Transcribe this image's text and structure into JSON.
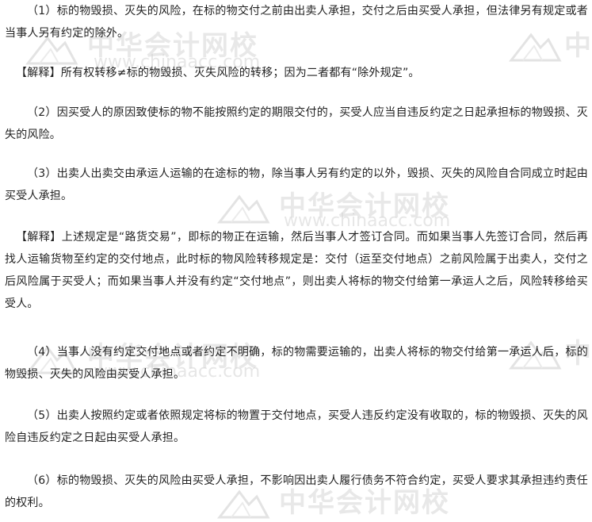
{
  "document": {
    "paragraphs": [
      "（1）标的物毁损、灭失的风险，在标的物交付之前由出卖人承担，交付之后由买受人承担，但法律另有规定或者当事人另有约定的除外。",
      "【解释】所有权转移≠标的物毁损、灭失风险的转移；因为二者都有“除外规定”。",
      "（2）因买受人的原因致使标的物不能按照约定的期限交付的，买受人应当自违反约定之日起承担标的物毁损、灭失的风险。",
      "（3）出卖人出卖交由承运人运输的在途标的物，除当事人另有约定的以外，毁损、灭失的风险自合同成立时起由买受人承担。",
      "【解释】上述规定是“路货交易”，即标的物正在运输，然后当事人才签订合同。而如果当事人先签订合同，然后再找人运输货物至约定的交付地点，此时标的物风险转移规定是：交付（运至交付地点）之前风险属于出卖人，交付之后风险属于买受人；而如果当事人并没有约定“交付地点”，则出卖人将标的物交付给第一承运人之后，风险转移给买受人。",
      "（4）当事人没有约定交付地点或者约定不明确，标的物需要运输的，出卖人将标的物交付给第一承运人后，标的物毁损、灭失的风险由买受人承担。",
      "（5）出卖人按照约定或者依照规定将标的物置于交付地点，买受人违反约定没有收取的，标的物毁损、灭失的风险自违反约定之日起由买受人承担。",
      "（6）标的物毁损、灭失的风险由买受人承担，不影响因出卖人履行债务不符合约定，买受人要求其承担违约责任的权利。"
    ]
  },
  "watermark": {
    "name_cn": "中华会计网校",
    "url": "www.chinaacc.com"
  },
  "colors": {
    "text": "#222222",
    "watermark": "#d6d6d6",
    "background": "#ffffff"
  }
}
